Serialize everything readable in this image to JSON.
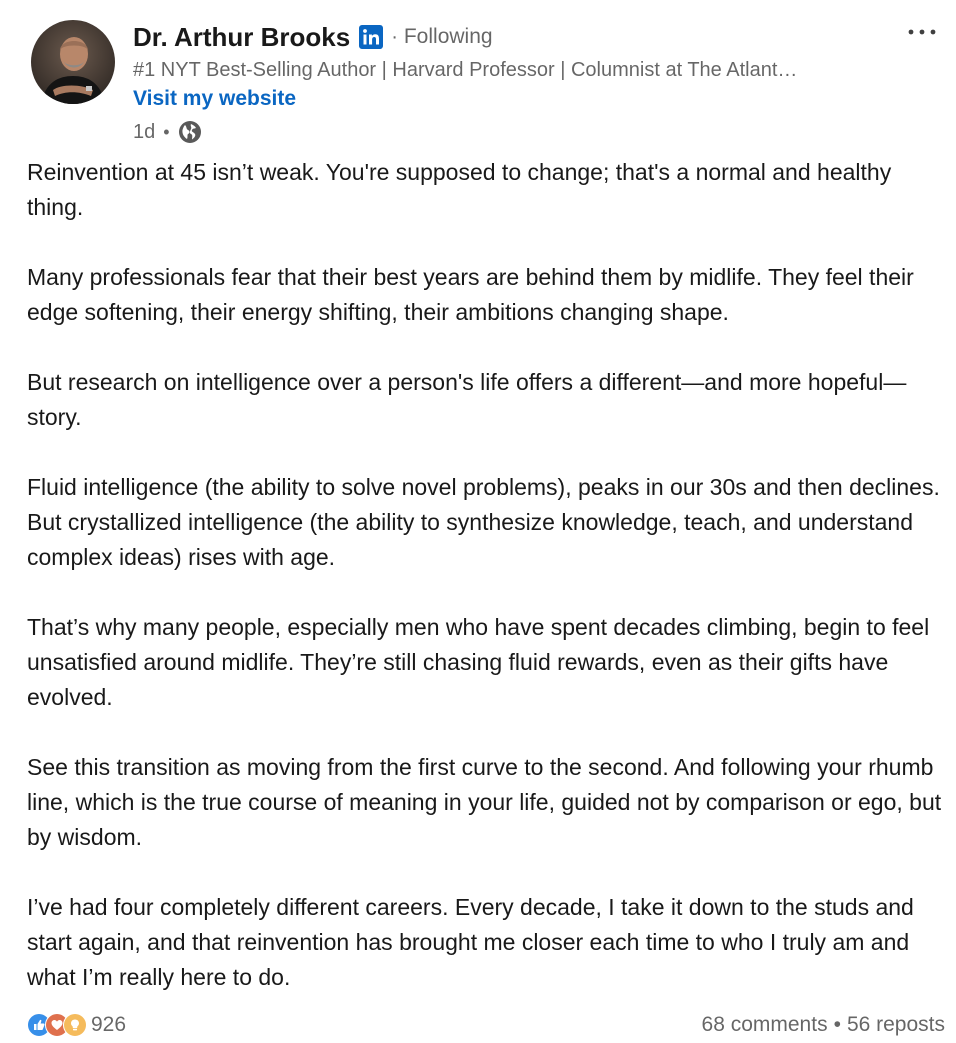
{
  "author": {
    "name": "Dr. Arthur Brooks",
    "follow_status": "Following",
    "headline": "#1 NYT Best-Selling Author | Harvard Professor | Columnist at The Atlant…",
    "website_link": "Visit my website",
    "timestamp": "1d",
    "visibility_icon": "globe-icon",
    "badge_icon": "linkedin-icon"
  },
  "post": {
    "paragraphs": [
      "Reinvention at 45 isn’t weak. You're supposed to change; that's a normal and healthy thing.",
      "Many professionals fear that their best years are behind them by midlife. They feel their edge softening, their energy shifting, their ambitions changing shape.",
      "But research on intelligence over a person's life offers a different—and more hopeful—story.",
      "Fluid intelligence (the ability to solve novel problems), peaks in our 30s and then declines. But crystallized intelligence (the ability to synthesize knowledge, teach, and understand complex ideas) rises with age.",
      "That’s why many people, especially men who have spent decades climbing, begin to feel unsatisfied around midlife. They’re still chasing fluid rewards, even as their gifts have evolved.",
      "See this transition as moving from the first curve to the second. And following your rhumb line, which is the true course of meaning in your life, guided not by comparison or ego, but by wisdom.",
      "I’ve had four completely different careers. Every decade, I take it down to the studs and start again, and that reinvention has brought me closer each time to who I truly am and what I’m really here to do."
    ]
  },
  "social": {
    "reaction_icons": [
      "like-icon",
      "love-icon",
      "insightful-icon"
    ],
    "reaction_count": "926",
    "comments": "68 comments",
    "reposts": "56 reposts",
    "separator": "•"
  },
  "colors": {
    "link_blue": "#0a66c2",
    "secondary_text": "#666666",
    "like_blue": "#378fe9",
    "love_red": "#df704d",
    "insightful_yellow": "#f5bb5c"
  }
}
